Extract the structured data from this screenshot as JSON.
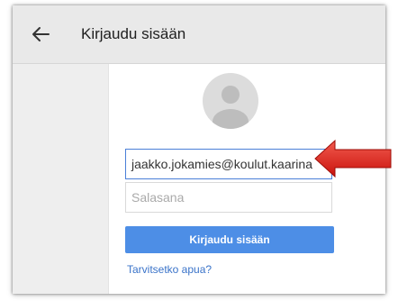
{
  "appbar": {
    "back_icon": "back-arrow-icon",
    "title": "Kirjaudu sisään"
  },
  "form": {
    "avatar_icon": "user-avatar-icon",
    "email_value": "jaakko.jokamies@koulut.kaarina",
    "password_placeholder": "Salasana",
    "submit_label": "Kirjaudu sisään",
    "help_link": "Tarvitsetko apua?"
  },
  "annotation": {
    "arrow_icon": "red-arrow-pointer-icon",
    "arrow_color": "#e2231a"
  },
  "colors": {
    "primary_button": "#4d8ee6",
    "link": "#3a73c9",
    "focus_border": "#4a7fd8"
  }
}
